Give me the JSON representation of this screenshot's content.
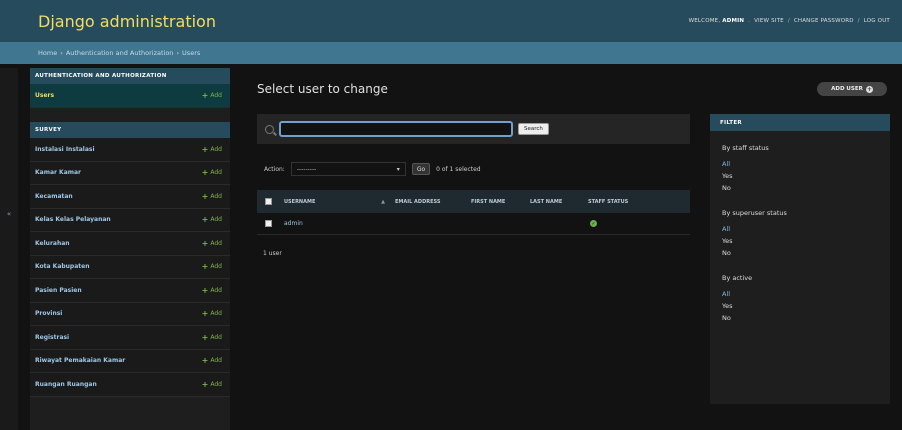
{
  "header": {
    "branding": "Django administration",
    "welcome": "WELCOME,",
    "username": "ADMIN",
    "links": [
      "VIEW SITE",
      "CHANGE PASSWORD",
      "LOG OUT"
    ]
  },
  "breadcrumbs": [
    "Home",
    "Authentication and Authorization",
    "Users"
  ],
  "sidebar": {
    "modules": [
      {
        "caption": "AUTHENTICATION AND AUTHORIZATION",
        "models": [
          {
            "name": "Users",
            "add": "Add",
            "current": true
          }
        ]
      },
      {
        "caption": "SURVEY",
        "models": [
          {
            "name": "Instalasi Instalasi",
            "add": "Add"
          },
          {
            "name": "Kamar Kamar",
            "add": "Add"
          },
          {
            "name": "Kecamatan",
            "add": "Add"
          },
          {
            "name": "Kelas Kelas Pelayanan",
            "add": "Add"
          },
          {
            "name": "Kelurahan",
            "add": "Add"
          },
          {
            "name": "Kota Kabupaten",
            "add": "Add"
          },
          {
            "name": "Pasien Pasien",
            "add": "Add"
          },
          {
            "name": "Provinsi",
            "add": "Add"
          },
          {
            "name": "Registrasi",
            "add": "Add"
          },
          {
            "name": "Riwayat Pemakaian Kamar",
            "add": "Add"
          },
          {
            "name": "Ruangan Ruangan",
            "add": "Add"
          }
        ]
      }
    ],
    "collapse_glyph": "«"
  },
  "main": {
    "title": "Select user to change",
    "add_button": "ADD USER",
    "search": {
      "value": "",
      "placeholder": "",
      "button": "Search"
    },
    "actions": {
      "label": "Action:",
      "selected": "---------",
      "go": "Go",
      "selection_info": "0 of 1 selected"
    },
    "table": {
      "columns": [
        "USERNAME",
        "EMAIL ADDRESS",
        "FIRST NAME",
        "LAST NAME",
        "STAFF STATUS"
      ],
      "rows": [
        {
          "username": "admin",
          "email": "",
          "first_name": "",
          "last_name": "",
          "staff_status": true
        }
      ]
    },
    "paginator": "1 user"
  },
  "filter": {
    "title": "FILTER",
    "groups": [
      {
        "heading": "By staff status",
        "options": [
          "All",
          "Yes",
          "No"
        ]
      },
      {
        "heading": "By superuser status",
        "options": [
          "All",
          "Yes",
          "No"
        ]
      },
      {
        "heading": "By active",
        "options": [
          "All",
          "Yes",
          "No"
        ]
      }
    ]
  },
  "colors": {
    "header_bg": "#264b5d",
    "branding": "#f5dd5d",
    "breadcrumbs_bg": "#417690",
    "link": "#9ec8e6",
    "add_green": "#7fb34f"
  },
  "icons": {
    "search": "search-icon",
    "add": "plus-icon",
    "add_user": "plus-circle-icon",
    "staff_true": "check-circle-icon",
    "sort": "sort-icon"
  }
}
